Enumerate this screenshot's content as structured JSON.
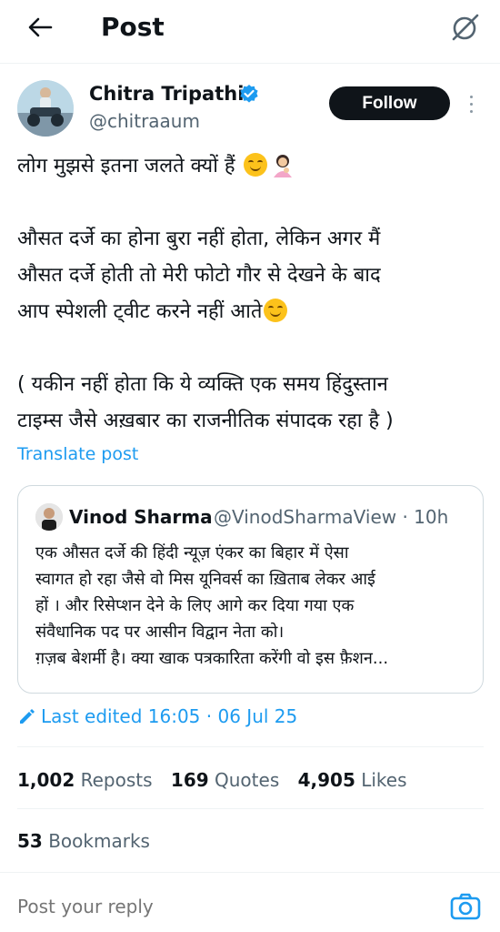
{
  "header": {
    "title": "Post"
  },
  "author": {
    "name": "Chitra Tripathi",
    "handle": "@chitraaum",
    "follow_label": "Follow"
  },
  "post": {
    "lines": [
      "लोग मुझसे इतना जलते क्यों हैं",
      "औसत दर्जे का होना बुरा नहीं होता, लेकिन अगर मैं",
      "औसत दर्जे होती तो मेरी फोटो गौर से देखने के बाद",
      "आप स्पेशली ट्वीट करने नहीं आते",
      "( यकीन नहीं होता कि ये व्यक्ति एक समय हिंदुस्तान",
      "टाइम्स जैसे अख़बार का राजनीतिक संपादक रहा है )"
    ],
    "translate_label": "Translate post"
  },
  "quote": {
    "name": "Vinod Sharma",
    "handle_time": "@VinodSharmaView · 10h",
    "lines": [
      "एक औसत दर्जे की हिंदी न्यूज़ एंकर का बिहार में ऐसा",
      "स्वागत हो रहा जैसे वो मिस यूनिवर्स का ख़िताब लेकर आई",
      "हों । और रिसेप्शन देने के लिए आगे कर दिया गया एक",
      "संवैधानिक पद पर आसीन विद्वान नेता को।",
      "ग़ज़ब बेशर्मी है। क्या खाक पत्रकारिता करेंगी वो इस फ़ैशन..."
    ]
  },
  "edited": {
    "label": "Last edited 16:05 · 06 Jul 25"
  },
  "stats": {
    "reposts": {
      "count": "1,002",
      "label": "Reposts"
    },
    "quotes": {
      "count": "169",
      "label": "Quotes"
    },
    "likes": {
      "count": "4,905",
      "label": "Likes"
    },
    "bookmarks": {
      "count": "53",
      "label": "Bookmarks"
    }
  },
  "reply": {
    "placeholder": "Post your reply"
  },
  "colors": {
    "accent": "#1d9bf0",
    "text": "#0f1419",
    "muted": "#536471",
    "border": "#cfd9de"
  },
  "icons": [
    "back-arrow-icon",
    "grok-icon",
    "verified-badge-icon",
    "more-options-icon",
    "smile-emoji-icon",
    "person-emoji-icon",
    "edit-pencil-icon",
    "camera-icon"
  ]
}
